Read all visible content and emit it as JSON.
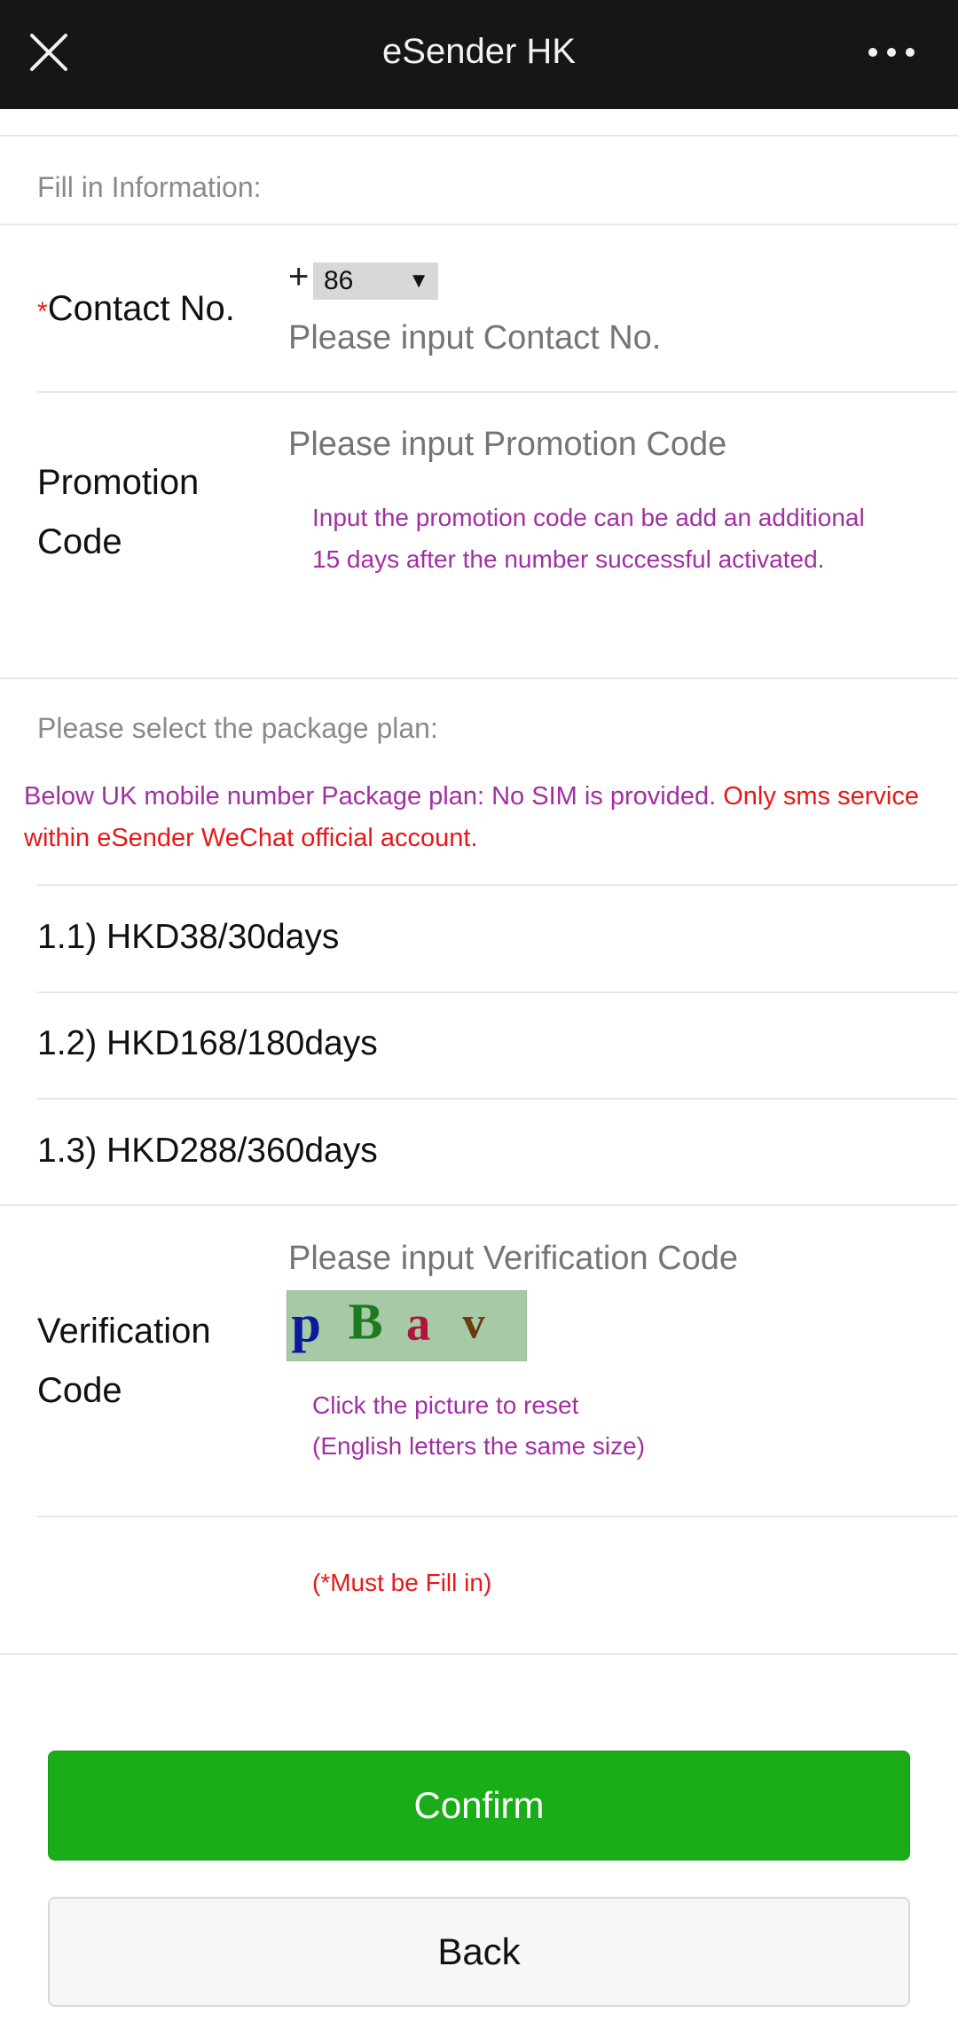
{
  "header": {
    "title": "eSender HK",
    "close_icon": "close-icon",
    "more_icon": "more-dots-icon"
  },
  "form": {
    "section_title": "Fill in Information:",
    "contact": {
      "required_mark": "*",
      "label": "Contact No.",
      "plus": "+",
      "country_code": "86",
      "dropdown_arrow": "▼",
      "placeholder": "Please input Contact No."
    },
    "promotion": {
      "label_line1": "Promotion",
      "label_line2": "Code",
      "placeholder": "Please input Promotion Code",
      "hint_line1": "Input the promotion code can be add an additional",
      "hint_line2": "15 days after the number successful activated."
    }
  },
  "packages": {
    "section_title": "Please select the package plan:",
    "notice_purple": "Below UK mobile number Package plan: No SIM is provided.",
    "notice_red": "Only sms service within eSender WeChat official account.",
    "plans": [
      "1.1) HKD38/30days",
      "1.2) HKD168/180days",
      "1.3) HKD288/360days"
    ]
  },
  "verification": {
    "label_line1": "Verification",
    "label_line2": "Code",
    "placeholder": "Please input Verification Code",
    "captcha_text": "p B a v",
    "captcha_chars": [
      "p",
      "B",
      "a",
      "v"
    ],
    "captcha_colors": [
      "#0a1a9a",
      "#1e7a1e",
      "#b0143c",
      "#6b3a10"
    ],
    "hint_line1": "Click the picture to reset",
    "hint_line2": "(English letters the same size)",
    "must_fill": "(*Must be Fill in)"
  },
  "buttons": {
    "confirm": "Confirm",
    "back": "Back"
  },
  "colors": {
    "topbar": "#161616",
    "confirm_green": "#1aad19",
    "hint_purple": "#a22fa2",
    "alert_red": "#e81818"
  }
}
